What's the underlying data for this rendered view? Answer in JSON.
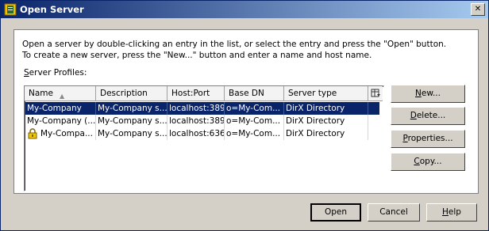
{
  "window": {
    "title": "Open Server",
    "close_label": "✕"
  },
  "intro": {
    "line1": "Open a server by double-clicking an entry in the list, or select the entry and press the \"Open\" button.",
    "line2": "To create a new server, press the \"New...\" button and enter a name and host name."
  },
  "list": {
    "label_first": "S",
    "label_rest": "erver Profiles:",
    "columns": [
      "Name",
      "Description",
      "Host:Port",
      "Base DN",
      "Server type"
    ],
    "rows": [
      {
        "name": "My-Company",
        "description": "My-Company s...",
        "host": "localhost:389",
        "base_dn": "o=My-Com...",
        "type": "DirX Directory",
        "selected": true,
        "locked": false
      },
      {
        "name": "My-Company (...",
        "description": "My-Company s...",
        "host": "localhost:389",
        "base_dn": "o=My-Com...",
        "type": "DirX Directory",
        "selected": false,
        "locked": false
      },
      {
        "name": "My-Compa...",
        "description": "My-Company s...",
        "host": "localhost:636",
        "base_dn": "o=My-Com...",
        "type": "DirX Directory",
        "selected": false,
        "locked": true
      }
    ]
  },
  "side_buttons": {
    "new": {
      "ul": "N",
      "rest": "ew..."
    },
    "delete": {
      "ul": "D",
      "rest": "elete..."
    },
    "properties": {
      "ul": "P",
      "rest": "roperties..."
    },
    "copy": {
      "ul": "C",
      "rest": "opy..."
    }
  },
  "footer": {
    "open_label": "Open",
    "cancel_label": "Cancel",
    "help_ul": "H",
    "help_rest": "elp"
  },
  "colors": {
    "title_start": "#0a246a",
    "title_end": "#a6caf0",
    "selection": "#0a246a",
    "face": "#d4d0c8"
  }
}
